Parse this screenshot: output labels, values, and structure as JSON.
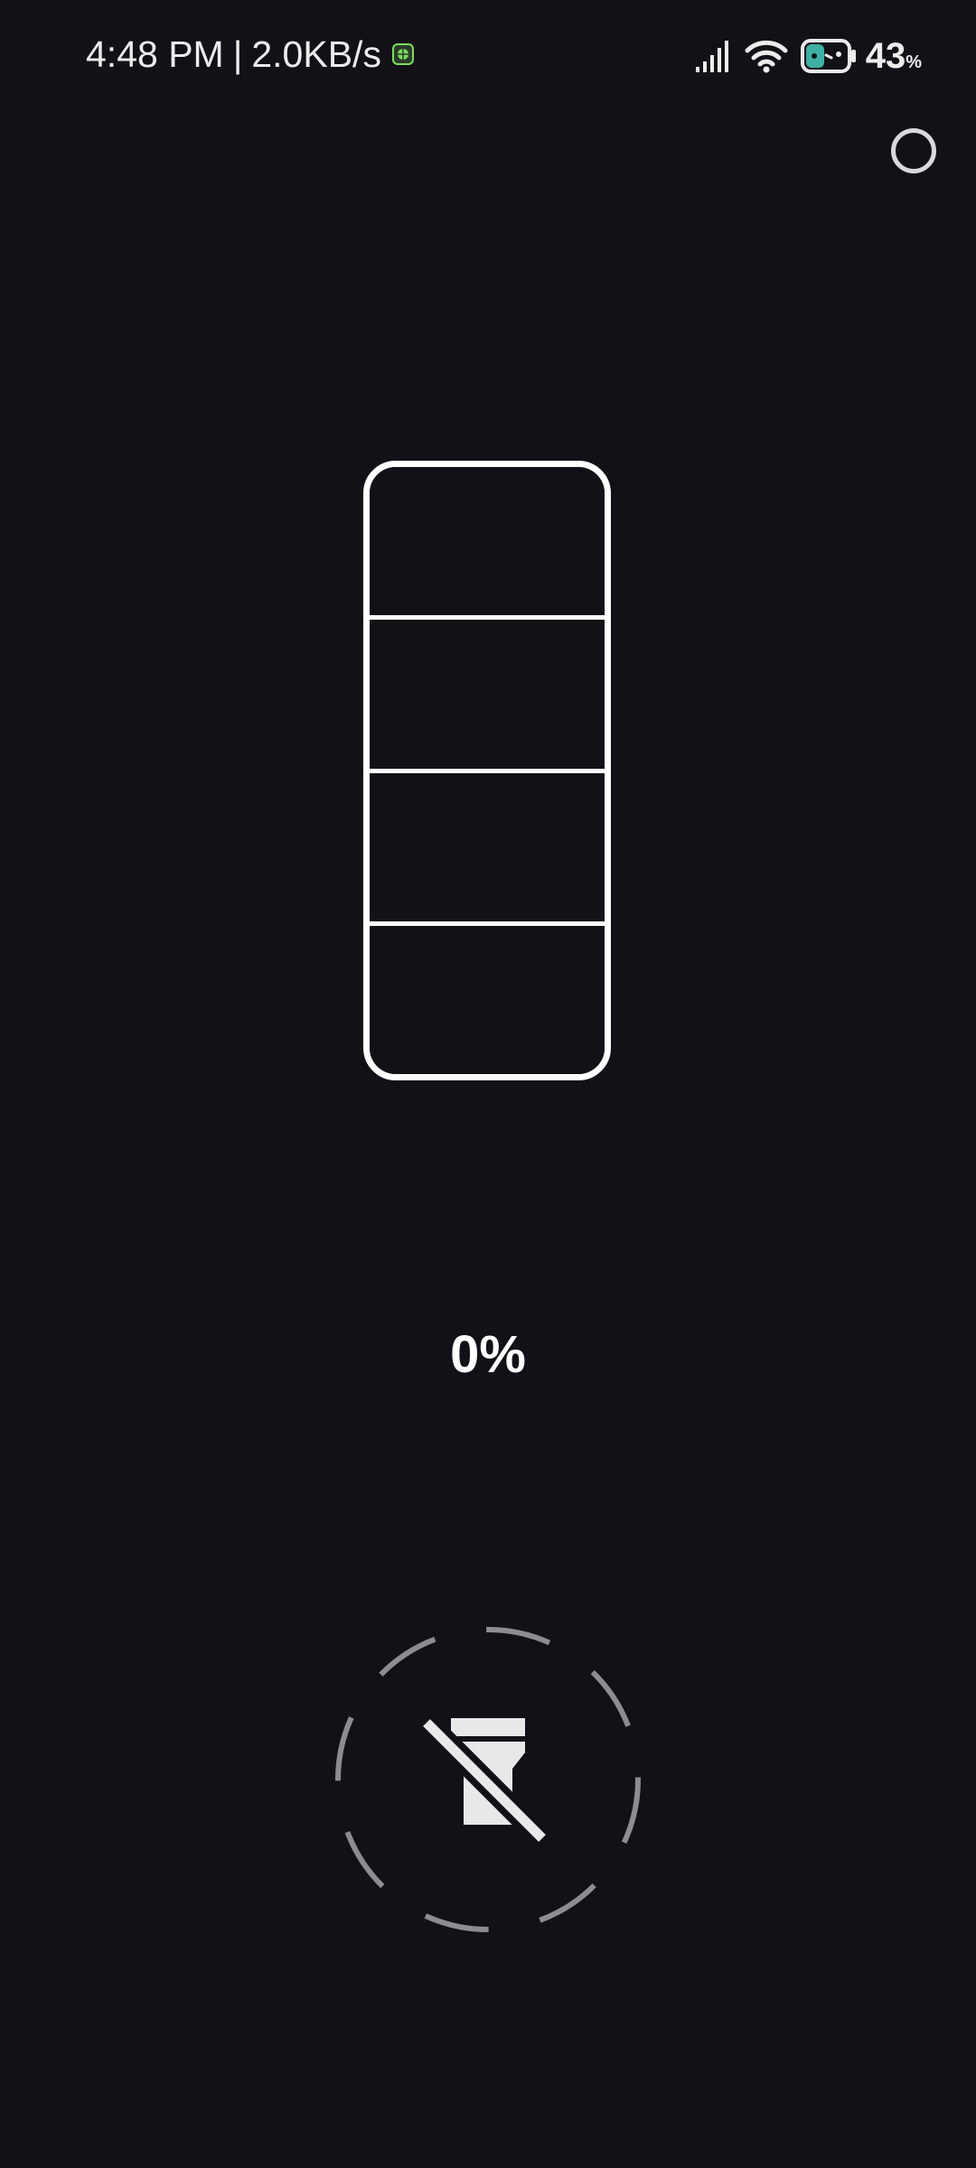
{
  "status_bar": {
    "time": "4:48 PM",
    "separator": "|",
    "network_speed": "2.0KB/s",
    "battery_value": "43",
    "battery_unit": "%",
    "icons": [
      "vpn-icon",
      "signal-icon",
      "wifi-icon",
      "battery-icon"
    ]
  },
  "screen_toggle": {
    "icon": "circle-outline-icon"
  },
  "level_meter": {
    "segments_total": 4,
    "segments_on": 0,
    "level_fraction": 0
  },
  "level_value": {
    "text": "0%"
  },
  "flashlight": {
    "state": "off",
    "icon": "flashlight-off-icon"
  },
  "colors": {
    "background": "#131117",
    "foreground": "#ffffff",
    "ring": "#8d8c90",
    "accent_vpn": "#7ddc5e",
    "battery_dot": "#3db0a3"
  }
}
